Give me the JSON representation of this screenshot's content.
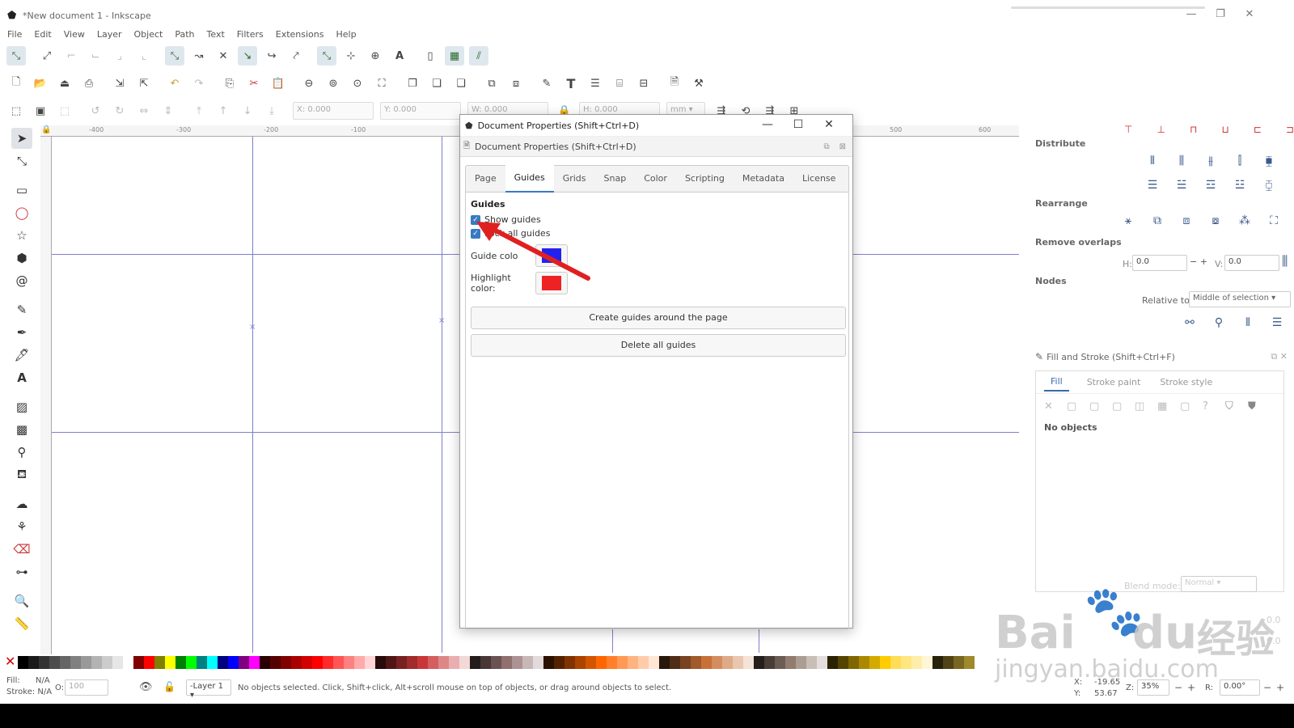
{
  "window": {
    "title": "*New document 1 - Inkscape",
    "min_glyph": "—",
    "restore_glyph": "❐",
    "close_glyph": "✕"
  },
  "menu": [
    "File",
    "Edit",
    "View",
    "Layer",
    "Object",
    "Path",
    "Text",
    "Filters",
    "Extensions",
    "Help"
  ],
  "toolbar": {
    "x": "X: 0.000",
    "y": "Y: 0.000",
    "w": "W: 0.000",
    "h": "H: 0.000",
    "units": "mm ▾"
  },
  "rulers": {
    "top": [
      "-400",
      "-300",
      "-200",
      "-100",
      "500",
      "600"
    ]
  },
  "dialog": {
    "window_title": "Document Properties (Shift+Ctrl+D)",
    "panel_title": "Document Properties (Shift+Ctrl+D)",
    "tabs": [
      "Page",
      "Guides",
      "Grids",
      "Snap",
      "Color",
      "Scripting",
      "Metadata",
      "License"
    ],
    "active_tab": "Guides",
    "section": "Guides",
    "show_guides": "Show guides",
    "lock_all_guides": "Lock all guides",
    "guide_color_label": "Guide colo",
    "highlight_color_label": "Highlight color:",
    "guide_color": "#2222ee",
    "highlight_color": "#ee2222",
    "create_button": "Create guides around the page",
    "delete_button": "Delete all guides"
  },
  "align_panel": {
    "distribute": "Distribute",
    "rearrange": "Rearrange",
    "remove_overlaps": "Remove overlaps",
    "h_label": "H:",
    "h_value": "0.0",
    "v_label": "V:",
    "v_value": "0.0",
    "nodes": "Nodes",
    "relative_to": "Relative to:",
    "relative_value": "Middle of selection ▾"
  },
  "fill_panel": {
    "title": "Fill and Stroke (Shift+Ctrl+F)",
    "tabs": [
      "Fill",
      "Stroke paint",
      "Stroke style"
    ],
    "no_objects": "No objects",
    "blend_label": "Blend mode:",
    "blend_value": "Normal ▾",
    "blur_value": "0.0",
    "opacity_value": "0.0"
  },
  "status": {
    "fill": "Fill:",
    "fill_value": "N/A",
    "stroke": "Stroke:",
    "stroke_value": "N/A",
    "o_label": "O:",
    "o_value": "100",
    "layer": "-Layer 1 ▾",
    "message": "No objects selected. Click, Shift+click, Alt+scroll mouse on top of objects, or drag around objects to select.",
    "x_label": "X:",
    "x_value": "-19.65",
    "y_label": "Y:",
    "y_value": "53.67",
    "z_label": "Z:",
    "zoom": "35%",
    "r_label": "R:",
    "rotation": "0.00°"
  },
  "watermark": {
    "text1": "Bai",
    "text2": "du",
    "text3": "经验",
    "url": "jingyan.baidu.com"
  },
  "palette": [
    "#000000",
    "#1a1a1a",
    "#333333",
    "#4d4d4d",
    "#666666",
    "#808080",
    "#999999",
    "#b3b3b3",
    "#cccccc",
    "#e6e6e6",
    "#ffffff",
    "#800000",
    "#ff0000",
    "#808000",
    "#ffff00",
    "#008000",
    "#00ff00",
    "#008080",
    "#00ffff",
    "#000080",
    "#0000ff",
    "#800080",
    "#ff00ff",
    "#2b0000",
    "#550000",
    "#800000",
    "#aa0000",
    "#d40000",
    "#ff0000",
    "#ff2a2a",
    "#ff5555",
    "#ff8080",
    "#ffaaaa",
    "#ffd5d5",
    "#280b0b",
    "#501616",
    "#782121",
    "#a02c2c",
    "#c83737",
    "#d35f5f",
    "#de8787",
    "#e9afaf",
    "#f4d7d7",
    "#241c1c",
    "#483737",
    "#6c5353",
    "#916f6f",
    "#ac9393",
    "#c8b7b7",
    "#e3dbdb",
    "#2b1100",
    "#552200",
    "#803300",
    "#aa4400",
    "#d45500",
    "#ff6600",
    "#ff7f2a",
    "#ff9955",
    "#ffb380",
    "#ffccaa",
    "#ffe6d5",
    "#28170b",
    "#502d16",
    "#784421",
    "#a05a2c",
    "#c87137",
    "#d38d5f",
    "#deaa87",
    "#e9c6af",
    "#f4e3d7",
    "#241f1c",
    "#483e37",
    "#6c5d53",
    "#917c6f",
    "#ac9d93",
    "#c8beb7",
    "#e3dedb",
    "#2b2200",
    "#554400",
    "#806600",
    "#aa8800",
    "#d4aa00",
    "#ffcc00",
    "#ffdd55",
    "#ffe680",
    "#ffeeaa",
    "#fff6d5",
    "#28220b",
    "#504416",
    "#786721",
    "#a0892c"
  ]
}
